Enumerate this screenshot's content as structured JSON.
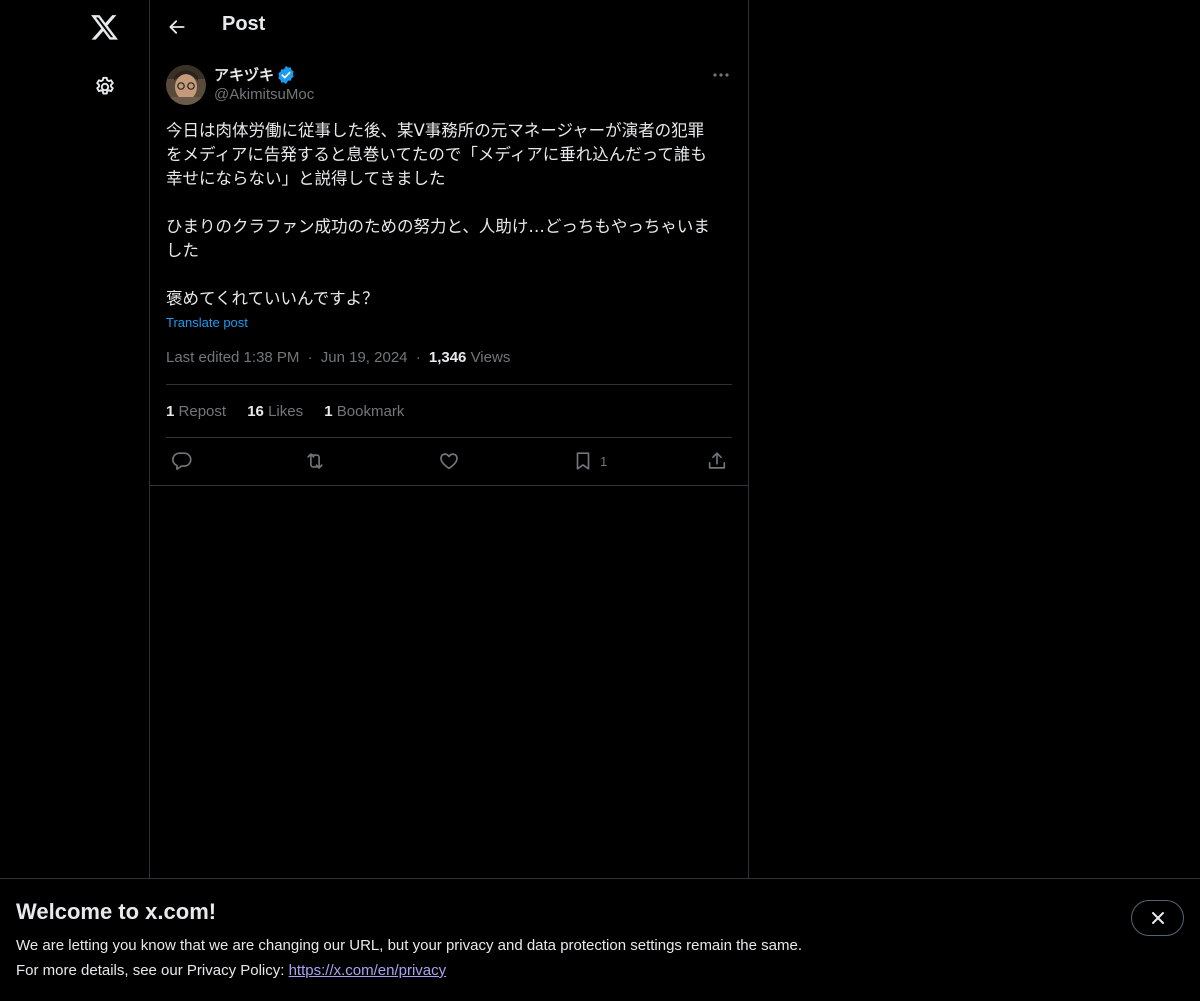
{
  "nav": {
    "logo_icon": "x-logo-icon",
    "settings_icon": "gear-icon"
  },
  "header": {
    "back_icon": "arrow-left-icon",
    "title": "Post"
  },
  "post": {
    "author": {
      "name": "アキヅキ",
      "handle": "@AkimitsuMoc",
      "verified": true
    },
    "text": {
      "line1": "今日は肉体労働に従事した後、某V事務所の元マネージャーが演者の犯罪",
      "line2": "をメディアに告発すると息巻いてたので「メディアに垂れ込んだって誰も",
      "line3": "幸せにならない」と説得してきました",
      "line4": "ひまりのクラファン成功のための努力と、人助け…どっちもやっちゃいま",
      "line5": "した",
      "line6": "褒めてくれていいんですよ？"
    },
    "translate_label": "Translate post",
    "meta": {
      "edited_time": "Last edited 1:38 PM",
      "separator": "·",
      "date": "Jun 19, 2024",
      "views_count": "1,346",
      "views_label": "Views"
    },
    "stats": {
      "reposts_count": "1",
      "reposts_label": "Repost",
      "likes_count": "16",
      "likes_label": "Likes",
      "bookmarks_count": "1",
      "bookmarks_label": "Bookmark"
    },
    "actions": {
      "bookmark_count": "1"
    }
  },
  "banner": {
    "title": "Welcome to x.com!",
    "line1": "We are letting you know that we are changing our URL, but your privacy and data protection settings remain the same.",
    "line2_prefix": "For more details, see our Privacy Policy: ",
    "link": "https://x.com/en/privacy"
  },
  "colors": {
    "background": "#000000",
    "text": "#e7e9ea",
    "muted": "#71767b",
    "accent": "#1d9bf0",
    "border": "#2f3336",
    "link_visited": "#a9a2f5"
  }
}
